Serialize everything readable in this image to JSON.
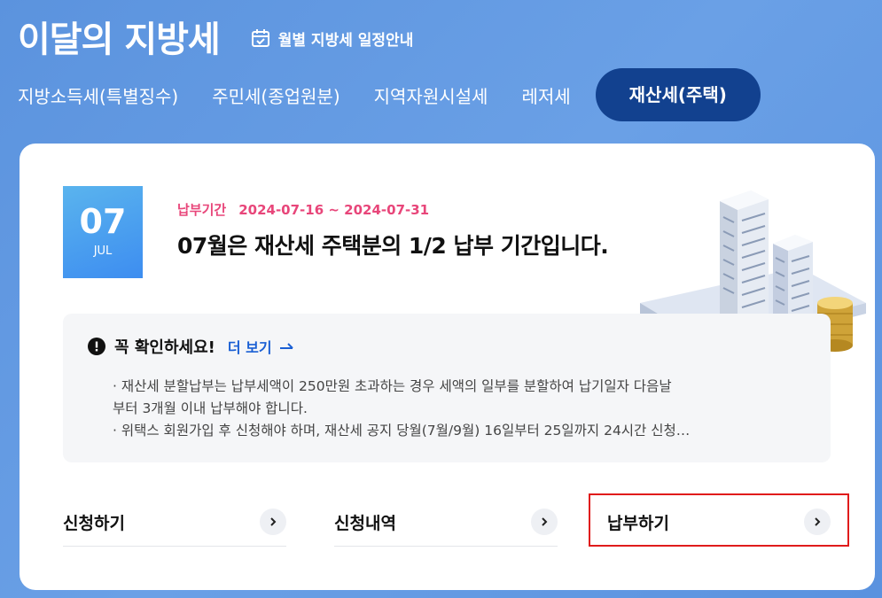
{
  "header": {
    "title": "이달의 지방세",
    "schedule_link": "월별 지방세 일정안내"
  },
  "tabs": [
    {
      "label": "지방소득세(특별징수)",
      "active": false
    },
    {
      "label": "주민세(종업원분)",
      "active": false
    },
    {
      "label": "지역자원시설세",
      "active": false
    },
    {
      "label": "레저세",
      "active": false
    },
    {
      "label": "재산세(주택)",
      "active": true
    }
  ],
  "date": {
    "day": "07",
    "month": "JUL"
  },
  "period": {
    "label": "납부기간",
    "range": "2024-07-16 ~ 2024-07-31"
  },
  "headline": "07월은 재산세 주택분의 1/2 납부 기간입니다.",
  "notice": {
    "title": "꼭 확인하세요!",
    "more": "더 보기",
    "lines": [
      "· 재산세 분할납부는 납부세액이 250만원 초과하는 경우 세액의 일부를 분할하여 납기일자 다음날",
      "부터 3개월 이내 납부해야 합니다.",
      "· 위택스 회원가입 후 신청해야 하며, 재산세 공지 당월(7월/9월) 16일부터 25일까지 24시간 신청…"
    ]
  },
  "actions": [
    {
      "label": "신청하기"
    },
    {
      "label": "신청내역"
    },
    {
      "label": "납부하기"
    }
  ],
  "colors": {
    "background": "#6aa0e6",
    "active_tab": "#12418f",
    "period": "#e8467a",
    "more_link": "#1a5fd4",
    "highlight": "#e01b1b"
  },
  "icons": [
    "calendar-check-icon",
    "alert-circle-icon",
    "arrow-right-icon",
    "chevron-right-icon",
    "building-illustration"
  ]
}
